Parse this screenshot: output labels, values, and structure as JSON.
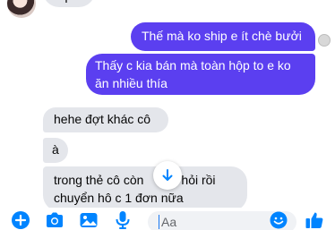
{
  "messages": [
    {
      "sender": "them",
      "text": "nqua"
    },
    {
      "sender": "me",
      "text": "Thế mà ko ship e ít chè bưởi"
    },
    {
      "sender": "me",
      "text": "Thấy c kia bán mà toàn hộp to e ko ăn nhiều thía"
    },
    {
      "sender": "them",
      "text": "hehe đợt khác cô"
    },
    {
      "sender": "them",
      "text": "à"
    },
    {
      "sender": "them",
      "text": "trong thẻ cô còn        c hỏi rồi chuyển hô c 1 đơn nữa"
    }
  ],
  "composer": {
    "placeholder": "Aa"
  },
  "colors": {
    "accent": "#0084ff",
    "outgoing_bubble": "#5b3ff0",
    "incoming_bubble": "#e4e6eb"
  },
  "icons": [
    "plus-circle-icon",
    "camera-icon",
    "image-icon",
    "microphone-icon",
    "emoji-icon",
    "thumbs-up-icon",
    "arrow-down-icon"
  ]
}
